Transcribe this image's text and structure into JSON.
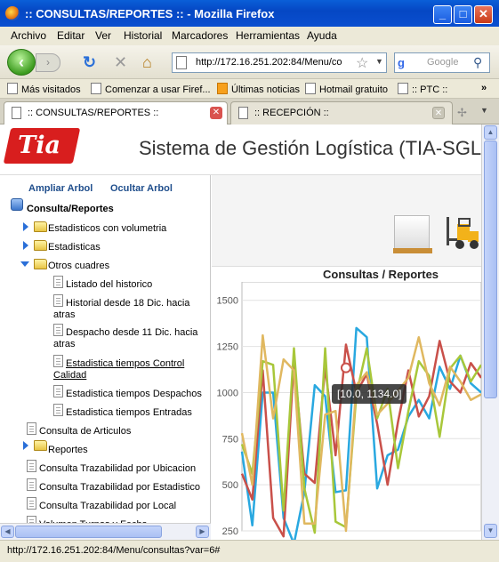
{
  "window": {
    "title": ":: CONSULTAS/REPORTES :: - Mozilla Firefox",
    "minimize": "_",
    "maximize": "□",
    "close": "✕"
  },
  "menu": [
    "Archivo",
    "Editar",
    "Ver",
    "Historial",
    "Marcadores",
    "Herramientas",
    "Ayuda"
  ],
  "nav": {
    "url": "http://172.16.251.202:84/Menu/co",
    "search_placeholder": "Google"
  },
  "bookmarks": [
    "Más visitados",
    "Comenzar a usar Firef...",
    "Últimas noticias",
    "Hotmail gratuito",
    ":: PTC ::"
  ],
  "tabs": [
    {
      "label": ":: CONSULTAS/REPORTES ::"
    },
    {
      "label": ":: RECEPCIÓN ::"
    }
  ],
  "page": {
    "app_title": "Sistema de Gestión Logística (TIA-SGL)",
    "logo_text": "Tia",
    "expand_tree": "Ampliar Arbol",
    "hide_tree": "Ocultar Arbol",
    "tree": {
      "root": "Consulta/Reportes",
      "items": {
        "estadisticos_vol": "Estadisticos con volumetria",
        "estadisticas": "Estadisticas",
        "otros_cuadres": "Otros cuadres",
        "listado_historico": "Listado del historico",
        "historial_18dic_1": "Historial desde 18 Dic. hacia",
        "historial_18dic_2": "atras",
        "despacho_11dic_1": "Despacho desde 11 Dic. hacia",
        "despacho_11dic_2": "atras",
        "est_control_1": "Estadistica tiempos Control",
        "est_control_2": "Calidad",
        "est_despachos": "Estadistica tiempos Despachos",
        "est_entradas": "Estadistica tiempos Entradas",
        "consulta_articulos": "Consulta de Articulos",
        "reportes": "Reportes",
        "traz_ubicacion": "Consulta Trazabilidad por Ubicacion",
        "traz_estadistico": "Consulta Trazabilidad por Estadistico",
        "traz_local": "Consulta Trazabilidad por Local",
        "cut_off": "Volumen Turnos y Fecha"
      }
    }
  },
  "status": "http://172.16.251.202:84/Menu/consultas?var=6#",
  "colors": {
    "brand_red": "#d81e1e",
    "series": [
      "#29a8e0",
      "#c9504a",
      "#a8c73a",
      "#e0b860"
    ]
  },
  "chart_data": {
    "type": "line",
    "title": "Consultas / Reportes",
    "ylim": [
      250,
      1600
    ],
    "yticks": [
      250,
      500,
      750,
      1000,
      1250,
      1500
    ],
    "x": [
      0,
      1,
      2,
      3,
      4,
      5,
      6,
      7,
      8,
      9,
      10,
      11,
      12,
      13,
      14,
      15,
      16,
      17,
      18,
      19,
      20,
      21,
      22,
      23
    ],
    "series": [
      {
        "values": [
          680,
          280,
          1000,
          1000,
          320,
          180,
          460,
          1040,
          980,
          460,
          470,
          1350,
          1300,
          480,
          660,
          690,
          870,
          960,
          860,
          1140,
          1020,
          1200,
          1050,
          1000
        ]
      },
      {
        "values": [
          560,
          420,
          1120,
          320,
          220,
          1180,
          560,
          510,
          1140,
          660,
          1260,
          1000,
          1100,
          830,
          500,
          840,
          1120,
          870,
          980,
          1280,
          1060,
          1000,
          1160,
          1080
        ]
      },
      {
        "values": [
          720,
          560,
          1170,
          1150,
          360,
          1240,
          480,
          240,
          1240,
          300,
          270,
          990,
          1240,
          860,
          1020,
          590,
          900,
          1170,
          1090,
          760,
          1130,
          1200,
          1060,
          1150
        ]
      },
      {
        "values": [
          780,
          500,
          1310,
          860,
          1180,
          1120,
          290,
          290,
          880,
          900,
          250,
          1040,
          1110,
          880,
          940,
          1010,
          1080,
          1300,
          1050,
          930,
          1140,
          1060,
          960,
          990
        ]
      }
    ],
    "tooltip": "[10.0, 1134.0]",
    "highlight": {
      "x": 10,
      "y": 1134
    }
  }
}
